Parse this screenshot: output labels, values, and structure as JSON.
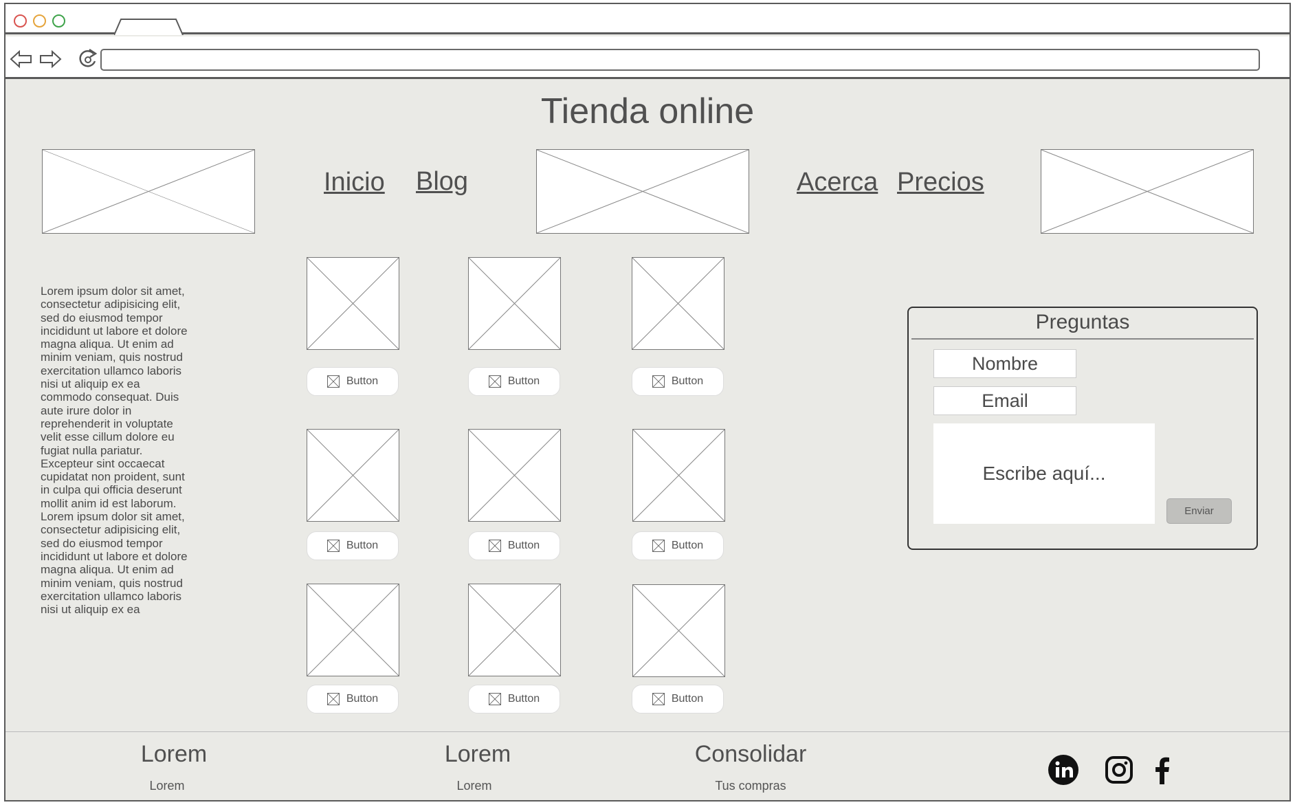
{
  "browser": {
    "window_buttons": [
      "close-dot",
      "minimize-dot",
      "maximize-dot"
    ],
    "colors": {
      "close": "#d9534f",
      "minimize": "#e5a43b",
      "maximize": "#3ea34a"
    },
    "url_value": ""
  },
  "header": {
    "title": "Tienda online",
    "nav": [
      "Inicio",
      "Blog",
      "Acerca",
      "Precios"
    ]
  },
  "sidebar": {
    "text": "Lorem ipsum dolor sit amet, consectetur adipisicing elit, sed do eiusmod tempor incididunt ut labore et dolore magna aliqua. Ut enim ad minim veniam, quis nostrud exercitation ullamco laboris nisi ut aliquip ex ea commodo consequat. Duis aute irure dolor in reprehenderit in voluptate velit esse cillum dolore eu fugiat nulla pariatur. Excepteur sint occaecat cupidatat non proident, sunt in culpa qui officia deserunt mollit anim id est laborum. Lorem ipsum dolor sit amet, consectetur adipisicing elit, sed do eiusmod tempor incididunt ut labore et dolore magna aliqua. Ut enim ad minim veniam, quis nostrud exercitation ullamco laboris nisi ut aliquip ex ea"
  },
  "products": {
    "button_label": "Button",
    "buttons": [
      "Button",
      "Button",
      "Button",
      "Button",
      "Button",
      "Button",
      "Button",
      "Button",
      "Button"
    ]
  },
  "form": {
    "title": "Preguntas",
    "name_label": "Nombre",
    "email_label": "Email",
    "message_placeholder": "Escribe aquí...",
    "submit_label": "Enviar"
  },
  "footer": {
    "columns": [
      {
        "heading": "Lorem",
        "sub": "Lorem"
      },
      {
        "heading": "Lorem",
        "sub": "Lorem"
      },
      {
        "heading": "Consolidar",
        "sub": "Tus compras"
      }
    ],
    "social": [
      "linkedin-icon",
      "instagram-icon",
      "facebook-icon"
    ]
  }
}
